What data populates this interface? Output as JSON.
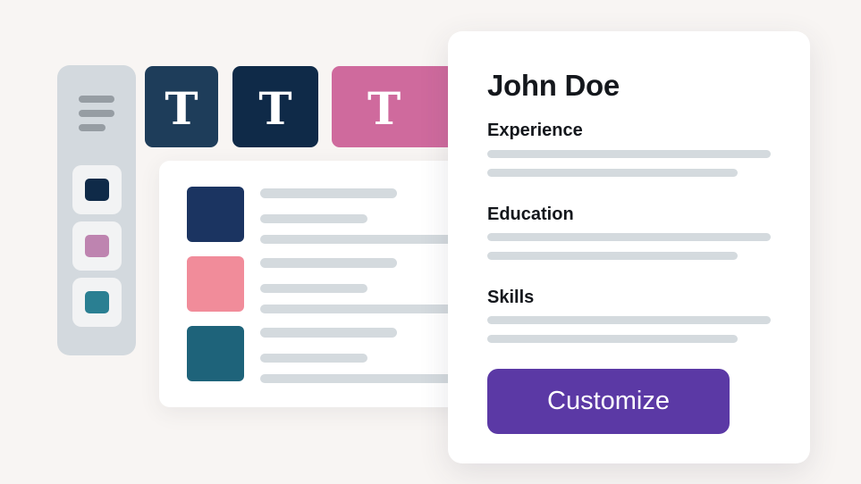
{
  "template_tiles": [
    {
      "glyph": "T",
      "color": "#1e3d5a"
    },
    {
      "glyph": "T",
      "color": "#0f2a48"
    },
    {
      "glyph": "T",
      "color": "#cf6a9d"
    }
  ],
  "sidebar": {
    "menu_icon": "hamburger-menu-icon",
    "color_swatches": [
      "#0f2a48",
      "#be84b0",
      "#2a7f92"
    ]
  },
  "template_list": {
    "rows": [
      {
        "thumb_color": "#1b3461"
      },
      {
        "thumb_color": "#f18c9a"
      },
      {
        "thumb_color": "#1e637a"
      }
    ]
  },
  "resume_card": {
    "name": "John Doe",
    "sections": [
      "Experience",
      "Education",
      "Skills"
    ],
    "button_label": "Customize",
    "button_color": "#5b39a5"
  }
}
